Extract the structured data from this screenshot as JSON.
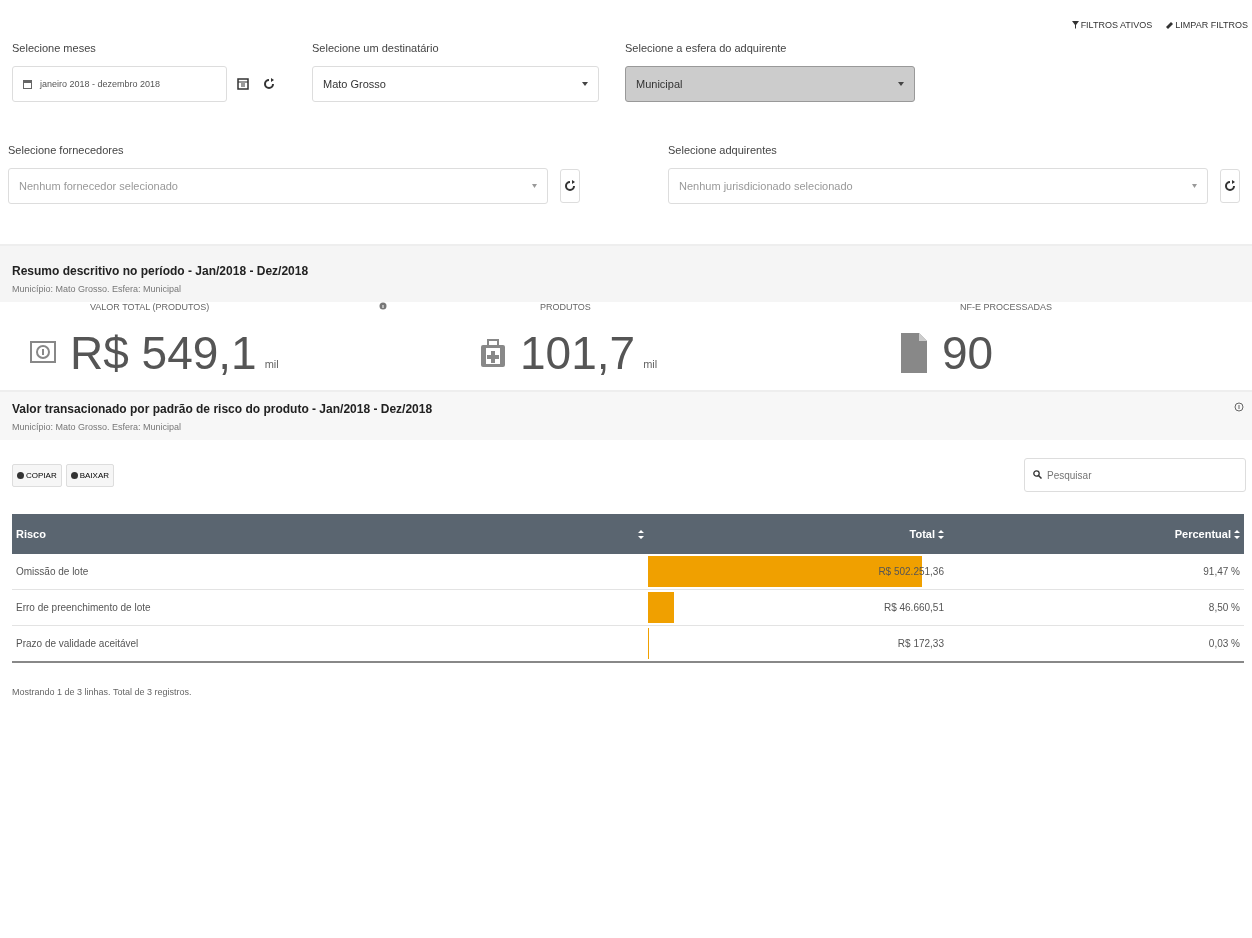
{
  "top_links": [
    "FILTROS ATIVOS",
    "LIMPAR FILTROS"
  ],
  "filters_row1": [
    {
      "kind": "daterange",
      "label": "Selecione meses",
      "value": "janeiro 2018 - dezembro 2018"
    },
    {
      "kind": "select",
      "label": "Selecione um destinatário",
      "value": "Mato Grosso",
      "disabled": false
    },
    {
      "kind": "select",
      "label": "Selecione a esfera do adquirente",
      "value": "Municipal",
      "disabled": true
    }
  ],
  "filters_row2": [
    {
      "label": "Selecione fornecedores",
      "placeholder": "Nenhum fornecedor selecionado"
    },
    {
      "label": "Selecione adquirentes",
      "placeholder": "Nenhum jurisdicionado selecionado"
    }
  ],
  "summary": {
    "title": "Resumo descritivo no período - Jan/2018 - Dez/2018",
    "subtitle": "Município: Mato Grosso. Esfera: Municipal",
    "stats": [
      {
        "kind": "money",
        "label": "VALOR TOTAL (PRODUTOS)",
        "info": true,
        "value": "R$ 549,1",
        "unit": "mil"
      },
      {
        "kind": "kit",
        "label": "PRODUTOS",
        "info": false,
        "value": "101,7",
        "unit": "mil"
      },
      {
        "kind": "file",
        "label": "NF-E PROCESSADAS",
        "info": false,
        "value": "90"
      }
    ]
  },
  "risk": {
    "title": "Valor transacionado por padrão de risco do produto - Jan/2018 - Dez/2018",
    "subtitle": "Município: Mato Grosso. Esfera: Municipal",
    "buttons": [
      "COPIAR",
      "BAIXAR"
    ],
    "search": {
      "placeholder": "Pesquisar"
    },
    "table": {
      "columns": [
        "Risco",
        "Total",
        "Percentual"
      ],
      "rows": [
        {
          "risco": "Omissão de lote",
          "total": "R$ 502.251,36",
          "level": 0.9147,
          "percentual": "91,47 %"
        },
        {
          "risco": "Erro de preenchimento de lote",
          "total": "R$ 46.660,51",
          "level": 0.085,
          "percentual": "8,50 %"
        },
        {
          "risco": "Prazo de validade aceitável",
          "total": "R$ 172,33",
          "level": 0.0003,
          "percentual": "0,03 %"
        }
      ]
    },
    "footer": "Mostrando 1 de 3 linhas. Total de 3 registros."
  }
}
